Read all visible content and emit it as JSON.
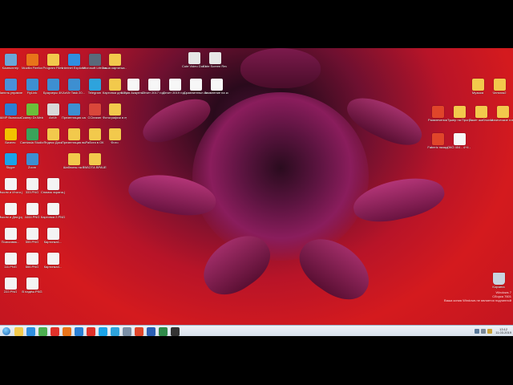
{
  "desktop": {
    "icons_col1": [
      {
        "label": "Компьютер",
        "icon": "computer-icon"
      },
      {
        "label": "Панель управления",
        "icon": "control-panel-icon"
      },
      {
        "label": "AIMP Выписка",
        "icon": "aimp-icon"
      },
      {
        "label": "Бизнес",
        "icon": "star-icon"
      },
      {
        "label": "Skype",
        "icon": "skype-icon"
      },
      {
        "label": "Мысли и Итоги.jpg",
        "icon": "image-file-icon"
      },
      {
        "label": "Мысли и Дни.jpg",
        "icon": "image-file-icon"
      },
      {
        "label": "Поисковик...",
        "icon": "image-file-icon"
      },
      {
        "label": "111.PNG",
        "icon": "image-file-icon"
      },
      {
        "label": "222.PNG",
        "icon": "image-file-icon"
      }
    ],
    "icons_col2": [
      {
        "label": "Mozilla Firefox",
        "icon": "firefox-icon"
      },
      {
        "label": "FlyLink",
        "icon": "app-icon"
      },
      {
        "label": "Сканер Dr.Web",
        "icon": "drweb-icon"
      },
      {
        "label": "Camtasia Studio 8",
        "icon": "camtasia-icon"
      },
      {
        "label": "Zoom",
        "icon": "app-icon"
      },
      {
        "label": "333.PNG",
        "icon": "image-file-icon"
      },
      {
        "label": "4444.PNG",
        "icon": "image-file-icon"
      },
      {
        "label": "555.PNG",
        "icon": "image-file-icon"
      },
      {
        "label": "666.PNG",
        "icon": "image-file-icon"
      },
      {
        "label": "В надёж.PNG",
        "icon": "image-file-icon"
      }
    ],
    "icons_col3": [
      {
        "label": "Program Files",
        "icon": "folder-icon"
      },
      {
        "label": "Браузеры 4K",
        "icon": "app-icon"
      },
      {
        "label": "AnVir",
        "icon": "anvir-icon"
      },
      {
        "label": "Яндекс Диск",
        "icon": "folder-icon"
      },
      {
        "label": "Снимок экрана.jpg",
        "icon": "image-file-icon"
      },
      {
        "label": "Картинка 2.PNG",
        "icon": "image-file-icon"
      },
      {
        "label": "Картинка1...",
        "icon": "image-file-icon"
      },
      {
        "label": "Картинка4...",
        "icon": "image-file-icon"
      }
    ],
    "icons_col4": [
      {
        "label": "Internet Explorer",
        "icon": "ie-icon"
      },
      {
        "label": "AnVir Task 20...",
        "icon": "app-icon"
      },
      {
        "label": "Презентация самонак...",
        "icon": "app-icon"
      },
      {
        "label": "Презентация выход...",
        "icon": "folder-icon"
      },
      {
        "label": "Шаблоны на 8",
        "icon": "folder-icon"
      }
    ],
    "icons_col5": [
      {
        "label": "Microsoft LifeCam",
        "icon": "lifecam-icon"
      },
      {
        "label": "Telegram",
        "icon": "telegram-icon"
      },
      {
        "label": "CCleaner",
        "icon": "ccleaner-icon"
      },
      {
        "label": "Работа в ОК",
        "icon": "folder-icon"
      },
      {
        "label": "РАБОТА ВРАЧЕЙ",
        "icon": "folder-icon"
      }
    ],
    "icons_col6": [
      {
        "label": "наша картинка...",
        "icon": "folder-icon"
      },
      {
        "label": "Картинки для Програм...",
        "icon": "folder-icon"
      },
      {
        "label": "Фотографии в пути",
        "icon": "folder-icon"
      },
      {
        "label": "Фото",
        "icon": "folder-icon"
      }
    ],
    "icons_top_middle": [
      {
        "label": "Копия Акаунты Н...",
        "icon": "doc-icon"
      },
      {
        "label": "Отчет 2017 год.docx",
        "icon": "doc-icon"
      },
      {
        "label": "Отчет 2019 год.docx",
        "icon": "doc-icon"
      },
      {
        "label": "Сравнительн анализ - 2...",
        "icon": "doc-icon"
      },
      {
        "label": "Заявление на корреспо...",
        "icon": "doc-icon"
      }
    ],
    "icons_video": [
      {
        "label": "Cute Video Dub Free...",
        "icon": "film-icon"
      },
      {
        "label": "Cute Screen Recorder BUS",
        "icon": "film-icon"
      }
    ],
    "icons_right_top": [
      {
        "label": "Музыка",
        "icon": "folder-icon"
      },
      {
        "label": "Чельтаз2",
        "icon": "folder-icon"
      }
    ],
    "icons_right_mid": [
      {
        "label": "Развлечения",
        "icon": "pdf-icon"
      },
      {
        "label": "Тумер на Программ...",
        "icon": "folder-icon"
      },
      {
        "label": "Пакет шаблонов",
        "icon": "folder-icon"
      },
      {
        "label": "Магические гитары",
        "icon": "folder-icon"
      }
    ],
    "icons_right_low": [
      {
        "label": "Faberic назад",
        "icon": "pdf-icon"
      },
      {
        "label": "ОКО 404 - 4+4 - Форм...",
        "icon": "doc-icon"
      }
    ],
    "recycle_bin": {
      "label": "Корзина",
      "icon": "recycle-bin-icon"
    }
  },
  "watermark": {
    "line1": "Windows 7",
    "line2": "Сборка 7601",
    "line3": "Ваша копия Windows не является подлинной"
  },
  "taskbar": {
    "pinned": [
      "explorer-icon",
      "ie-icon",
      "chrome-icon",
      "opera-icon",
      "firefox-icon",
      "aimp-icon",
      "yandex-icon",
      "skype-icon",
      "telegram-icon",
      "app-icon",
      "pdf-icon",
      "word-icon",
      "excel-icon",
      "video-icon"
    ],
    "clock_time": "13:12",
    "clock_date": "11.03.2019"
  },
  "colors": {
    "wallpaper_red": "#c8151f",
    "flower_magenta": "#8a1a52",
    "taskbar_bg": "#dfe6ef"
  }
}
